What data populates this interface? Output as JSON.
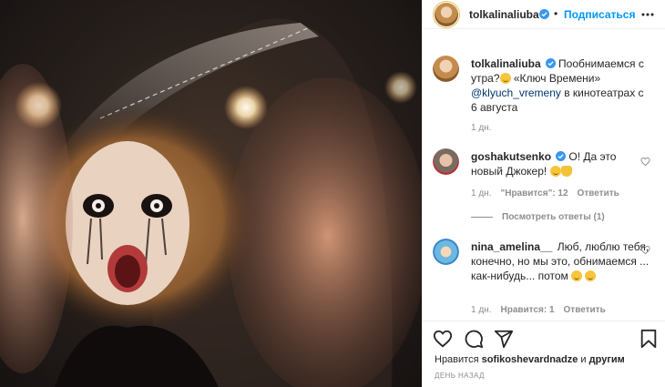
{
  "header": {
    "username": "tolkalinaliuba",
    "follow_dot": "•",
    "follow_label": "Подписаться"
  },
  "caption": {
    "username": "tolkalinaliuba",
    "text_before": "Пообнимаемся с утра?",
    "text_quote": " «Ключ Времени»",
    "mention": "@klyuch_vremeny",
    "text_after": " в кинотеатрах с 6 августа",
    "time": "1 дн."
  },
  "comments": [
    {
      "username": "goshakutsenko",
      "text": "О! Да это новый Джокер!",
      "time": "1 дн.",
      "likes": "\"Нравится\": 12",
      "reply": "Ответить",
      "view_replies": "Посмотреть ответы (1)"
    },
    {
      "username": "nina_amelina__",
      "text": "Люб, люблю тебя, конечно, но мы это, обнимаемся ... как-нибудь... потом",
      "time": "1 дн.",
      "likes": "Нравится: 1",
      "reply": "Ответить"
    }
  ],
  "footer": {
    "likes_prefix": "Нравится ",
    "likes_user": "sofikoshevardnadze",
    "likes_mid": " и ",
    "likes_others": "другим",
    "time_ago": "ДЕНЬ НАЗАД"
  },
  "colors": {
    "accent": "#0095f6",
    "verified": "#3897f0",
    "muted": "#8e8e8e",
    "text": "#262626"
  },
  "icons": [
    "verified-badge-icon",
    "more-options-icon",
    "heart-icon",
    "comment-icon",
    "share-icon",
    "bookmark-icon"
  ]
}
